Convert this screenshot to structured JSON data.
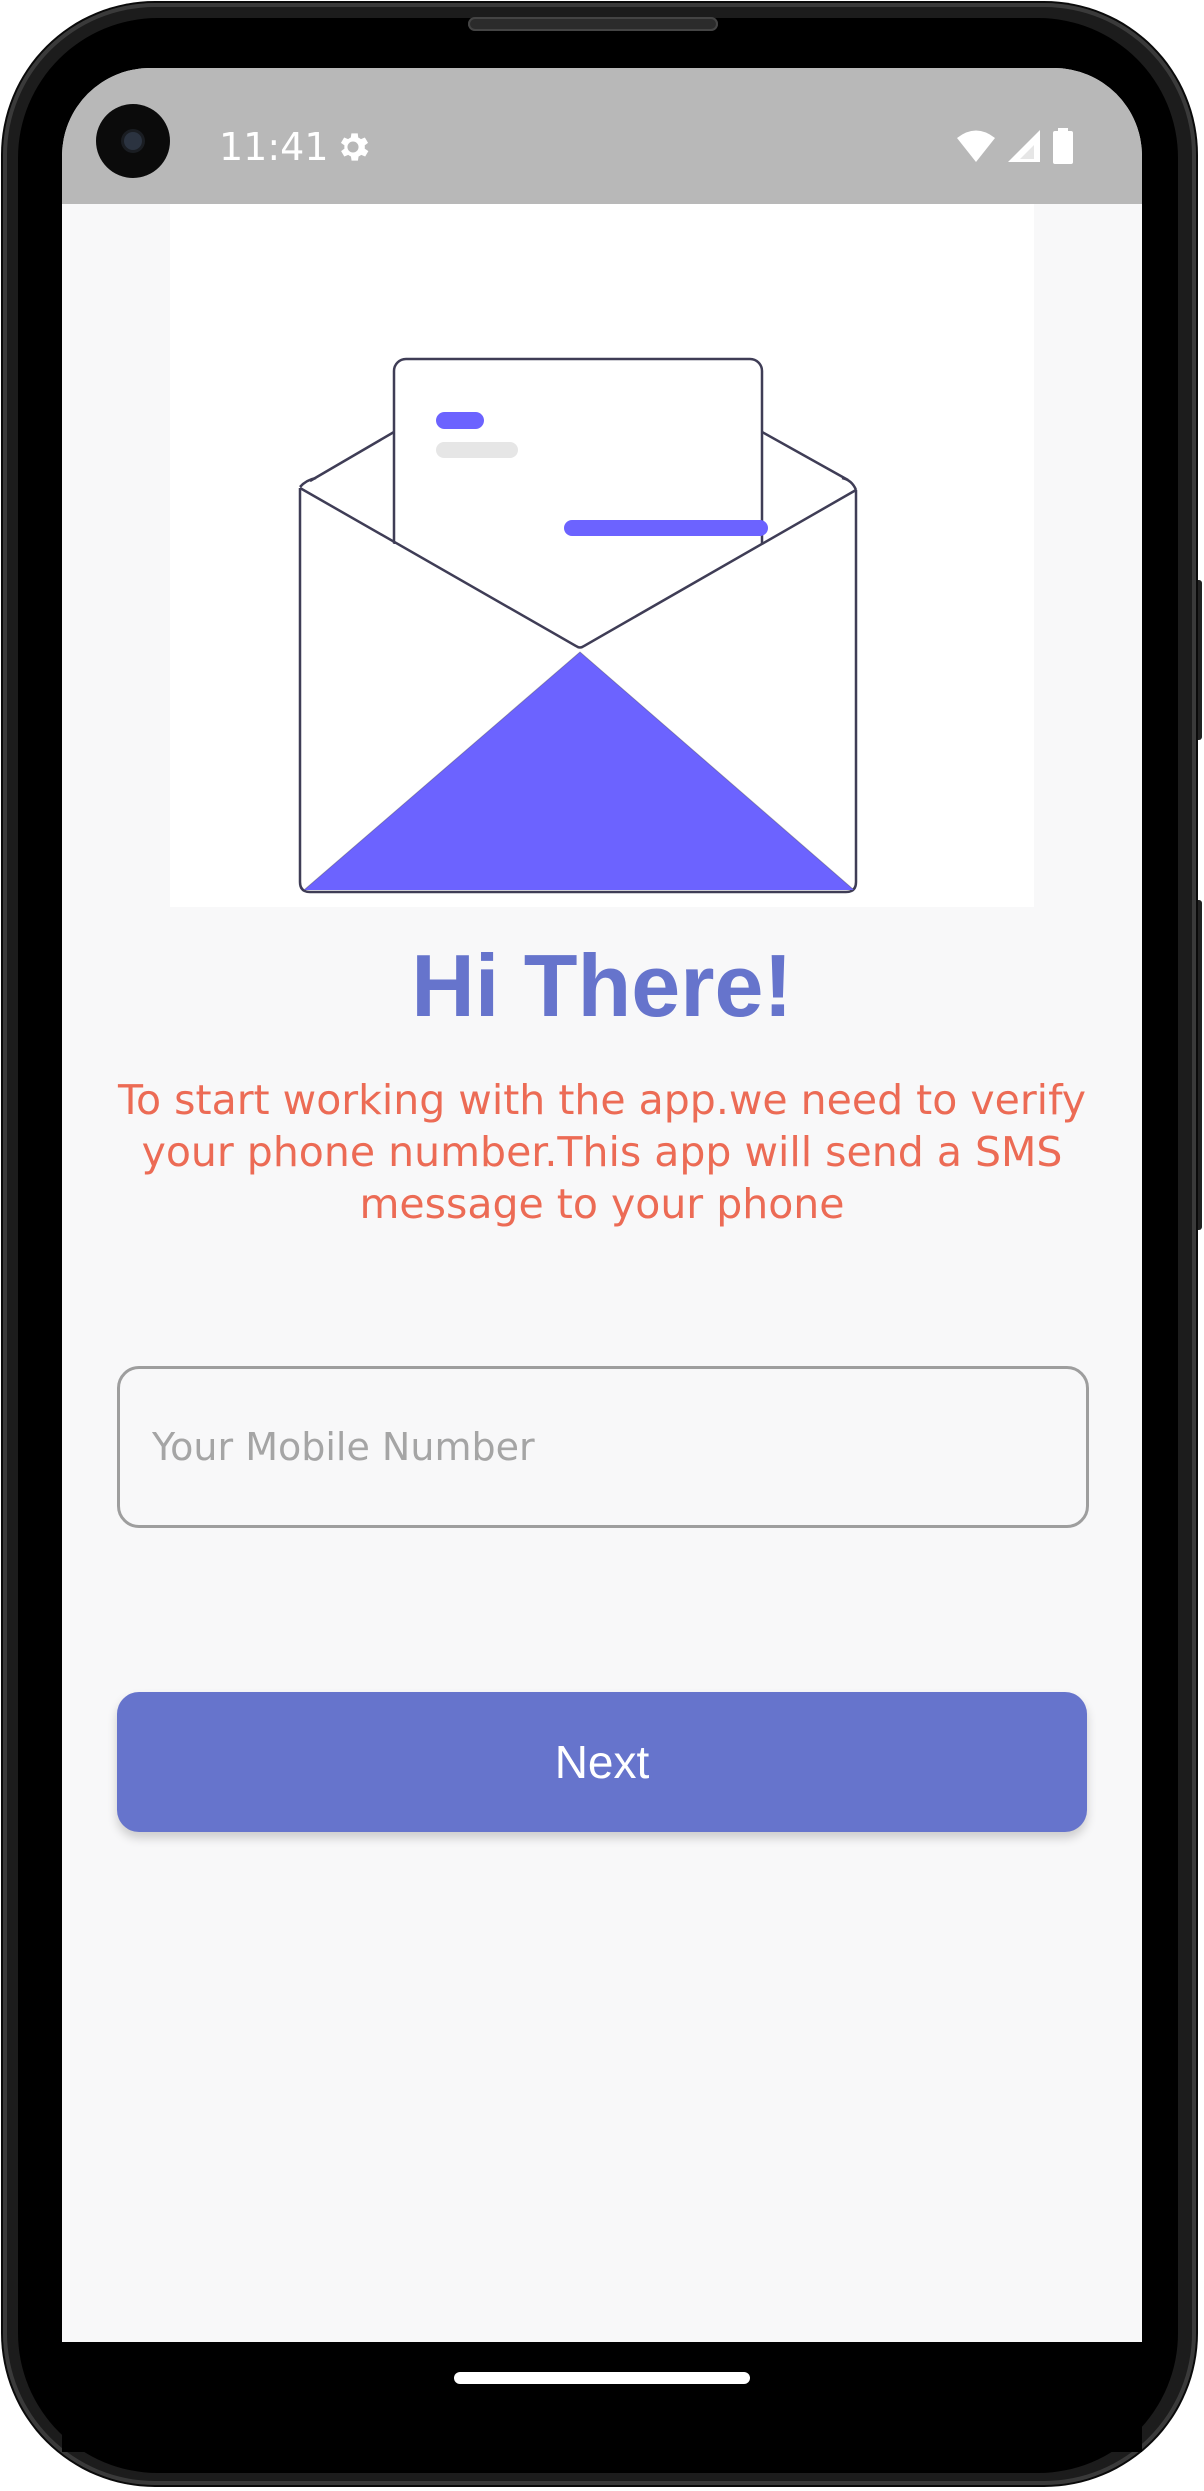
{
  "status_bar": {
    "time": "11:41",
    "icons": [
      "settings-gear-icon",
      "wifi-icon",
      "cellular-signal-icon",
      "battery-icon"
    ]
  },
  "illustration": {
    "icon": "open-envelope-letter-icon",
    "accent_color": "#6c63ff"
  },
  "main": {
    "title": "Hi There!",
    "description": "To start working with the app.we need to verify your phone number.This app will send a SMS message to your phone",
    "phone_input": {
      "placeholder": "Your Mobile Number",
      "value": ""
    },
    "next_label": "Next"
  },
  "colors": {
    "primary": "#6674cc",
    "description_text": "#ec6b55",
    "background": "#f8f8f9"
  }
}
